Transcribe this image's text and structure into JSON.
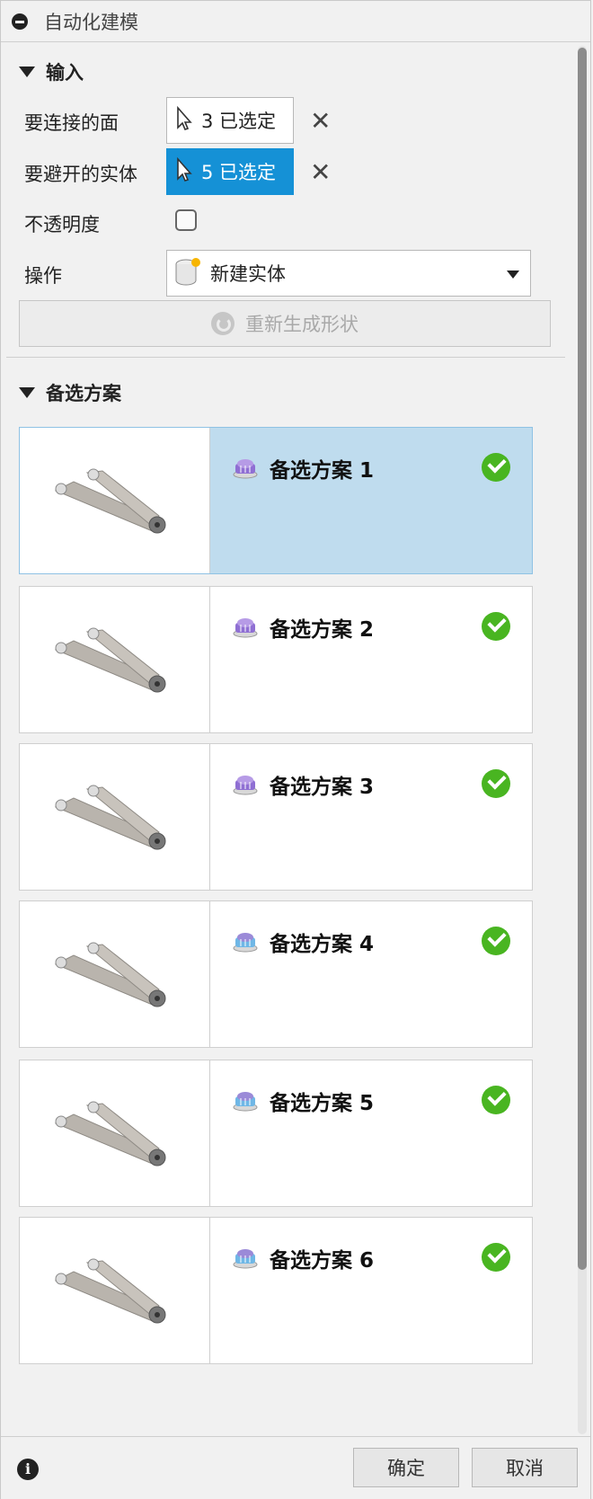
{
  "window": {
    "title": "自动化建模"
  },
  "input_section": {
    "header": "输入",
    "faces_label": "要连接的面",
    "faces_selection": "3 已选定",
    "avoid_label": "要避开的实体",
    "avoid_selection": "5 已选定",
    "opacity_label": "不透明度",
    "operation_label": "操作",
    "operation_value": "新建实体",
    "regenerate_label": "重新生成形状"
  },
  "alternatives_section": {
    "header": "备选方案",
    "items": [
      {
        "label": "备选方案 1",
        "icon": "purple-stack-icon",
        "status": "complete",
        "selected": true
      },
      {
        "label": "备选方案 2",
        "icon": "purple-stack-icon",
        "status": "complete",
        "selected": false
      },
      {
        "label": "备选方案 3",
        "icon": "purple-stack-icon",
        "status": "complete",
        "selected": false
      },
      {
        "label": "备选方案 4",
        "icon": "blue-stack-icon",
        "status": "complete",
        "selected": false
      },
      {
        "label": "备选方案 5",
        "icon": "blue-stack-icon",
        "status": "complete",
        "selected": false
      },
      {
        "label": "备选方案 6",
        "icon": "blue-stack-icon",
        "status": "complete",
        "selected": false
      }
    ]
  },
  "footer": {
    "ok_label": "确定",
    "cancel_label": "取消"
  },
  "colors": {
    "accent_blue": "#1591d6",
    "selected_card_bg": "#bfdcee",
    "status_green": "#49b521",
    "panel_bg": "#f1f1f1"
  }
}
